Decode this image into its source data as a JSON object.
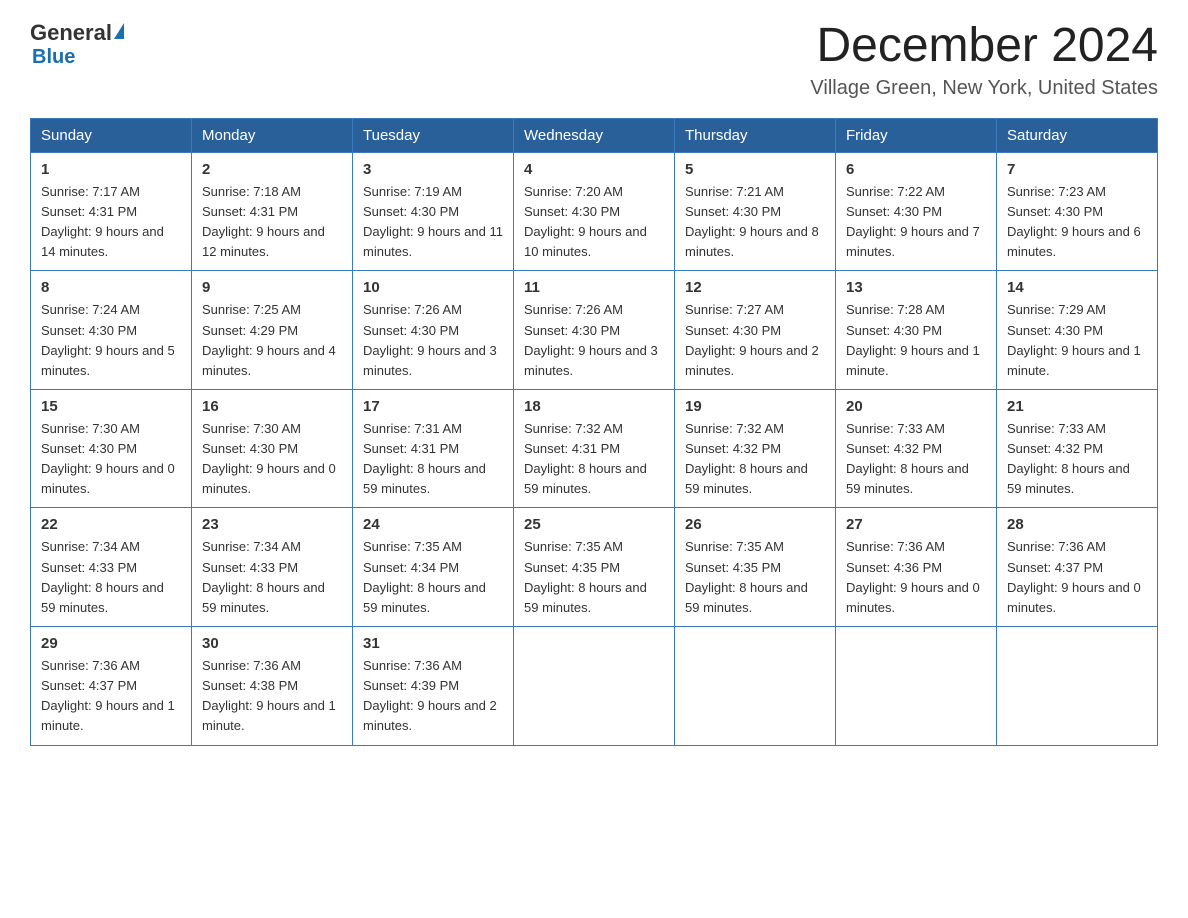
{
  "header": {
    "logo_general": "General",
    "logo_blue": "Blue",
    "month_title": "December 2024",
    "location": "Village Green, New York, United States"
  },
  "weekdays": [
    "Sunday",
    "Monday",
    "Tuesday",
    "Wednesday",
    "Thursday",
    "Friday",
    "Saturday"
  ],
  "weeks": [
    [
      {
        "day": "1",
        "sunrise": "7:17 AM",
        "sunset": "4:31 PM",
        "daylight": "9 hours and 14 minutes."
      },
      {
        "day": "2",
        "sunrise": "7:18 AM",
        "sunset": "4:31 PM",
        "daylight": "9 hours and 12 minutes."
      },
      {
        "day": "3",
        "sunrise": "7:19 AM",
        "sunset": "4:30 PM",
        "daylight": "9 hours and 11 minutes."
      },
      {
        "day": "4",
        "sunrise": "7:20 AM",
        "sunset": "4:30 PM",
        "daylight": "9 hours and 10 minutes."
      },
      {
        "day": "5",
        "sunrise": "7:21 AM",
        "sunset": "4:30 PM",
        "daylight": "9 hours and 8 minutes."
      },
      {
        "day": "6",
        "sunrise": "7:22 AM",
        "sunset": "4:30 PM",
        "daylight": "9 hours and 7 minutes."
      },
      {
        "day": "7",
        "sunrise": "7:23 AM",
        "sunset": "4:30 PM",
        "daylight": "9 hours and 6 minutes."
      }
    ],
    [
      {
        "day": "8",
        "sunrise": "7:24 AM",
        "sunset": "4:30 PM",
        "daylight": "9 hours and 5 minutes."
      },
      {
        "day": "9",
        "sunrise": "7:25 AM",
        "sunset": "4:29 PM",
        "daylight": "9 hours and 4 minutes."
      },
      {
        "day": "10",
        "sunrise": "7:26 AM",
        "sunset": "4:30 PM",
        "daylight": "9 hours and 3 minutes."
      },
      {
        "day": "11",
        "sunrise": "7:26 AM",
        "sunset": "4:30 PM",
        "daylight": "9 hours and 3 minutes."
      },
      {
        "day": "12",
        "sunrise": "7:27 AM",
        "sunset": "4:30 PM",
        "daylight": "9 hours and 2 minutes."
      },
      {
        "day": "13",
        "sunrise": "7:28 AM",
        "sunset": "4:30 PM",
        "daylight": "9 hours and 1 minute."
      },
      {
        "day": "14",
        "sunrise": "7:29 AM",
        "sunset": "4:30 PM",
        "daylight": "9 hours and 1 minute."
      }
    ],
    [
      {
        "day": "15",
        "sunrise": "7:30 AM",
        "sunset": "4:30 PM",
        "daylight": "9 hours and 0 minutes."
      },
      {
        "day": "16",
        "sunrise": "7:30 AM",
        "sunset": "4:30 PM",
        "daylight": "9 hours and 0 minutes."
      },
      {
        "day": "17",
        "sunrise": "7:31 AM",
        "sunset": "4:31 PM",
        "daylight": "8 hours and 59 minutes."
      },
      {
        "day": "18",
        "sunrise": "7:32 AM",
        "sunset": "4:31 PM",
        "daylight": "8 hours and 59 minutes."
      },
      {
        "day": "19",
        "sunrise": "7:32 AM",
        "sunset": "4:32 PM",
        "daylight": "8 hours and 59 minutes."
      },
      {
        "day": "20",
        "sunrise": "7:33 AM",
        "sunset": "4:32 PM",
        "daylight": "8 hours and 59 minutes."
      },
      {
        "day": "21",
        "sunrise": "7:33 AM",
        "sunset": "4:32 PM",
        "daylight": "8 hours and 59 minutes."
      }
    ],
    [
      {
        "day": "22",
        "sunrise": "7:34 AM",
        "sunset": "4:33 PM",
        "daylight": "8 hours and 59 minutes."
      },
      {
        "day": "23",
        "sunrise": "7:34 AM",
        "sunset": "4:33 PM",
        "daylight": "8 hours and 59 minutes."
      },
      {
        "day": "24",
        "sunrise": "7:35 AM",
        "sunset": "4:34 PM",
        "daylight": "8 hours and 59 minutes."
      },
      {
        "day": "25",
        "sunrise": "7:35 AM",
        "sunset": "4:35 PM",
        "daylight": "8 hours and 59 minutes."
      },
      {
        "day": "26",
        "sunrise": "7:35 AM",
        "sunset": "4:35 PM",
        "daylight": "8 hours and 59 minutes."
      },
      {
        "day": "27",
        "sunrise": "7:36 AM",
        "sunset": "4:36 PM",
        "daylight": "9 hours and 0 minutes."
      },
      {
        "day": "28",
        "sunrise": "7:36 AM",
        "sunset": "4:37 PM",
        "daylight": "9 hours and 0 minutes."
      }
    ],
    [
      {
        "day": "29",
        "sunrise": "7:36 AM",
        "sunset": "4:37 PM",
        "daylight": "9 hours and 1 minute."
      },
      {
        "day": "30",
        "sunrise": "7:36 AM",
        "sunset": "4:38 PM",
        "daylight": "9 hours and 1 minute."
      },
      {
        "day": "31",
        "sunrise": "7:36 AM",
        "sunset": "4:39 PM",
        "daylight": "9 hours and 2 minutes."
      },
      null,
      null,
      null,
      null
    ]
  ],
  "labels": {
    "sunrise_prefix": "Sunrise: ",
    "sunset_prefix": "Sunset: ",
    "daylight_prefix": "Daylight: "
  }
}
